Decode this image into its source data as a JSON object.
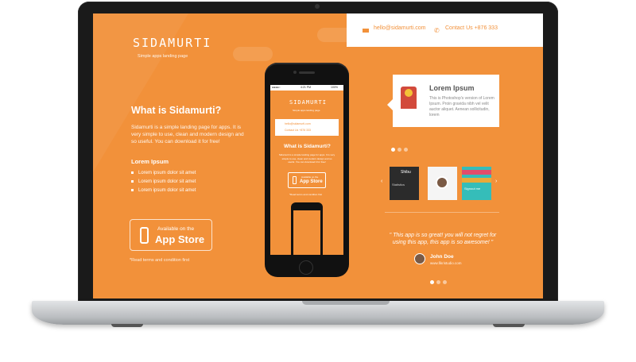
{
  "brand": {
    "logo": "SIDAMURTI",
    "tagline": "Simple apps landing page"
  },
  "contact": {
    "email": "hello@sidamurti.com",
    "phone": "Contact Us +876 333"
  },
  "left": {
    "title": "What is Sidamurti?",
    "text": "Sidamurti is a simple landing page for apps. It is very simple to use, clean and modern design and so useful. You can download it for free!",
    "list_title": "Lorem Ipsum",
    "list": [
      "Lorem ipsum dolor sit amet",
      "Lorem ipsum dolor sit amet",
      "Lorem ipsum dolor sit amet"
    ],
    "store_line1": "Available on the",
    "store_line2": "App Store",
    "terms": "*Read terms and condition first"
  },
  "phone": {
    "carrier": "●●●●○",
    "time": "4:21 PM",
    "battery": "100%",
    "logo": "SIDAMURTI",
    "tagline": "Simple apps landing page",
    "email": "hello@sidamurti.com",
    "contact": "Contact Us +876 333",
    "title": "What is Sidamurti?",
    "text": "Sidamurti is a simple landing page for apps. It is very simple to use, clean and modern design and so useful. You can download it for free!",
    "store_line1": "Available on the",
    "store_line2": "App Store",
    "terms": "*Read terms and condition first"
  },
  "feature_card": {
    "title": "Lorem Ipsum",
    "text": "This is Photoshop's version of Lorem Ipsum. Proin gravida nibh vel velit auctor aliquet. Aenean sollicitudin, lorem"
  },
  "thumbs": {
    "t1_title": "Shibu",
    "t1_sub": "Statistics",
    "t3_label": "Signout me"
  },
  "testimonial": {
    "quote": "\" This app is so great! you will not regret for using this app, this app is so awesome! \"",
    "name": "John Doe",
    "site": "www.fikristudio.com"
  },
  "colors": {
    "accent": "#f2913a",
    "card": "#ffffff"
  }
}
